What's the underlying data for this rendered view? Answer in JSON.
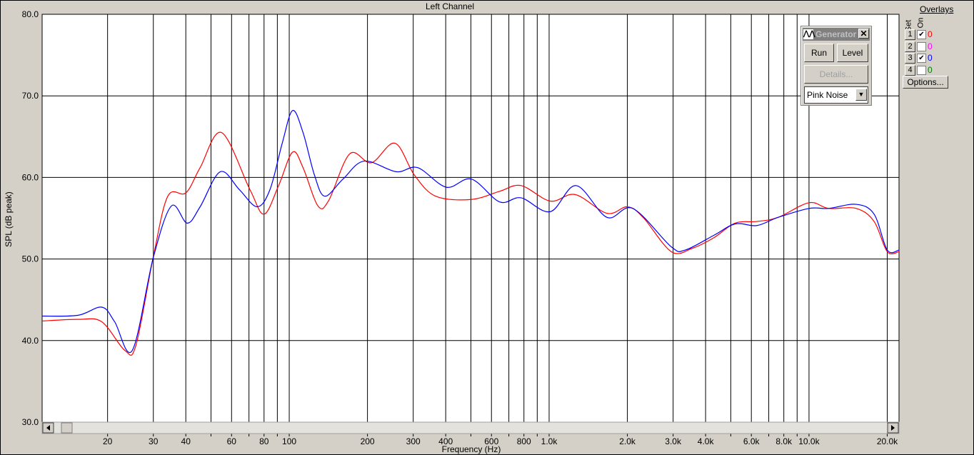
{
  "window": {
    "title": "Left Channel"
  },
  "generator": {
    "title": "Generator",
    "run": "Run",
    "level": "Level",
    "details": "Details...",
    "signal": "Pink Noise"
  },
  "overlays": {
    "title": "Overlays",
    "set_label": "Set",
    "on_label": "On",
    "options": "Options...",
    "rows": [
      {
        "set": "1",
        "on": true,
        "value": "0",
        "color": "#ff0000"
      },
      {
        "set": "2",
        "on": false,
        "value": "0",
        "color": "#ff00ff"
      },
      {
        "set": "3",
        "on": true,
        "value": "0",
        "color": "#0000ff"
      },
      {
        "set": "4",
        "on": false,
        "value": "0",
        "color": "#008000"
      }
    ]
  },
  "chart_data": {
    "type": "line",
    "title": "Left Channel",
    "xlabel": "Frequency (Hz)",
    "ylabel": "SPL (dB peak)",
    "xscale": "log",
    "xlim": [
      11.2,
      22200
    ],
    "ylim": [
      30,
      80
    ],
    "grid": true,
    "yticks": [
      "30.0",
      "40.0",
      "50.0",
      "60.0",
      "70.0",
      "80.0"
    ],
    "xticks": [
      [
        20,
        "20"
      ],
      [
        30,
        "30"
      ],
      [
        40,
        "40"
      ],
      [
        60,
        "60"
      ],
      [
        80,
        "80"
      ],
      [
        100,
        "100"
      ],
      [
        200,
        "200"
      ],
      [
        300,
        "300"
      ],
      [
        400,
        "400"
      ],
      [
        600,
        "600"
      ],
      [
        800,
        "800"
      ],
      [
        1000,
        "1.0k"
      ],
      [
        2000,
        "2.0k"
      ],
      [
        3000,
        "3.0k"
      ],
      [
        4000,
        "4.0k"
      ],
      [
        6000,
        "6.0k"
      ],
      [
        8000,
        "8.0k"
      ],
      [
        10000,
        "10.0k"
      ],
      [
        20000,
        "20.0k"
      ]
    ],
    "series": [
      {
        "color": "#ff0000",
        "points": [
          [
            11.2,
            42.4
          ],
          [
            15.4,
            42.6
          ],
          [
            19,
            42.3
          ],
          [
            23.3,
            38.8
          ],
          [
            25.7,
            39.4
          ],
          [
            30,
            50.3
          ],
          [
            34.1,
            57.7
          ],
          [
            40,
            58.1
          ],
          [
            45.4,
            61.2
          ],
          [
            54.9,
            65.5
          ],
          [
            70.6,
            58.5
          ],
          [
            80,
            55.5
          ],
          [
            91,
            59
          ],
          [
            103,
            63.1
          ],
          [
            113,
            61.2
          ],
          [
            129,
            56.5
          ],
          [
            142,
            57.2
          ],
          [
            171,
            62.9
          ],
          [
            207,
            61.8
          ],
          [
            255,
            64.2
          ],
          [
            303,
            60.3
          ],
          [
            366,
            57.7
          ],
          [
            502,
            57.3
          ],
          [
            645,
            58.3
          ],
          [
            780,
            59
          ],
          [
            1010,
            57.1
          ],
          [
            1260,
            57.9
          ],
          [
            1670,
            55.6
          ],
          [
            2000,
            56.4
          ],
          [
            2300,
            55.1
          ],
          [
            2950,
            50.9
          ],
          [
            3550,
            51.3
          ],
          [
            4300,
            52.6
          ],
          [
            5200,
            54.4
          ],
          [
            6300,
            54.6
          ],
          [
            7600,
            55.1
          ],
          [
            10000,
            56.9
          ],
          [
            11900,
            56.2
          ],
          [
            15200,
            56.2
          ],
          [
            17800,
            54.6
          ],
          [
            20000,
            50.9
          ],
          [
            22200,
            50.9
          ]
        ]
      },
      {
        "color": "#0000ff",
        "points": [
          [
            11.2,
            43.0
          ],
          [
            15.4,
            43.1
          ],
          [
            19,
            44.1
          ],
          [
            21.3,
            42.3
          ],
          [
            24.9,
            38.8
          ],
          [
            30,
            50.2
          ],
          [
            35.2,
            56.5
          ],
          [
            40.5,
            54.4
          ],
          [
            45.4,
            56.4
          ],
          [
            54.3,
            60.7
          ],
          [
            64.3,
            58.5
          ],
          [
            75.2,
            56.4
          ],
          [
            84.3,
            58.5
          ],
          [
            94,
            64.2
          ],
          [
            103,
            68.2
          ],
          [
            113,
            65.5
          ],
          [
            125,
            60.3
          ],
          [
            137,
            57.7
          ],
          [
            161,
            59.8
          ],
          [
            194,
            62
          ],
          [
            258,
            60.7
          ],
          [
            312,
            61.2
          ],
          [
            402,
            58.8
          ],
          [
            502,
            59.8
          ],
          [
            645,
            57
          ],
          [
            780,
            57.5
          ],
          [
            1010,
            55.8
          ],
          [
            1270,
            59
          ],
          [
            1670,
            55.1
          ],
          [
            2100,
            56.2
          ],
          [
            2950,
            51.5
          ],
          [
            3340,
            51.1
          ],
          [
            4300,
            52.9
          ],
          [
            5200,
            54.3
          ],
          [
            6300,
            54.1
          ],
          [
            7600,
            55.1
          ],
          [
            10000,
            56.2
          ],
          [
            11900,
            56.2
          ],
          [
            15200,
            56.7
          ],
          [
            17800,
            55.5
          ],
          [
            20000,
            51.1
          ],
          [
            22200,
            51.1
          ]
        ]
      }
    ]
  }
}
